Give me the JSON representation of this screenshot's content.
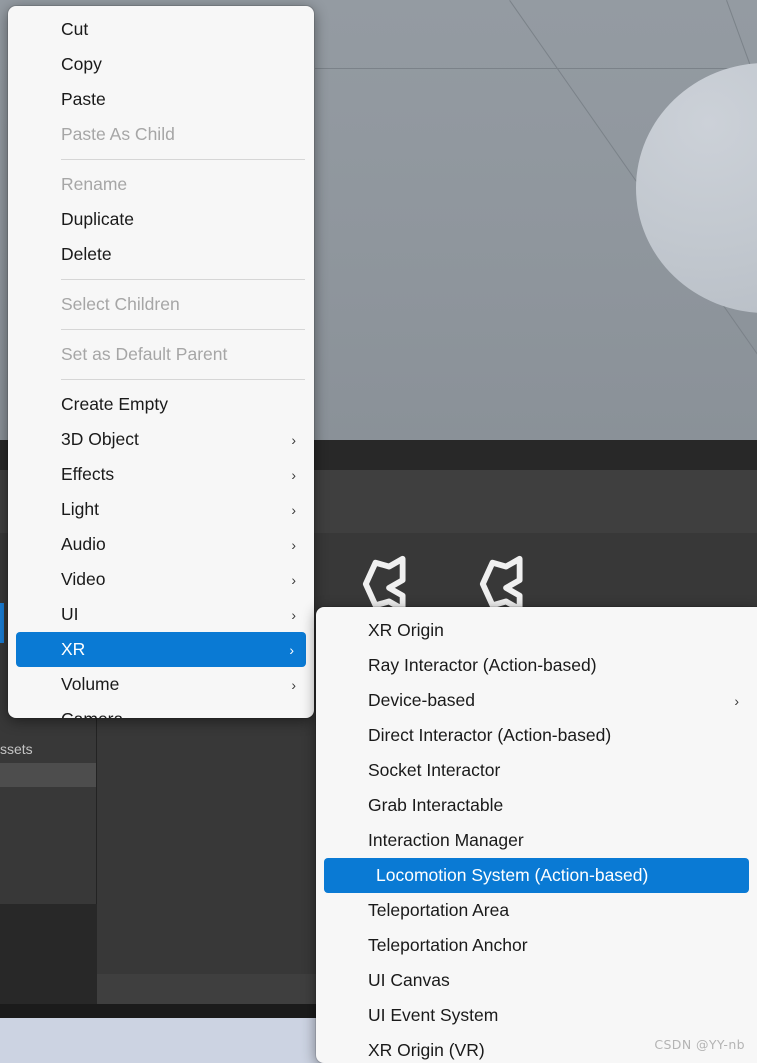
{
  "app": {
    "name": "Unity Editor",
    "watermark": "CSDN @YY-nb"
  },
  "background": {
    "scene_view": {
      "name": "Scene View",
      "objects": [
        "ground-plane",
        "sphere"
      ]
    },
    "project_panel": {
      "folder_label": "ssets",
      "asset_icons": [
        "unity-prefab-icon",
        "unity-prefab-icon"
      ]
    },
    "colors": {
      "scene_ground": "#92999f",
      "scene_sphere": "#c2c8cf",
      "panel": "#383838",
      "panel_dark": "#282828",
      "panel_mid": "#3f3f3f",
      "panel_black": "#1b1b1b",
      "status_strip": "#ccd3e2",
      "accent": "#0a7ad4"
    }
  },
  "context_menu": {
    "name": "hierarchy-context-menu",
    "items": [
      {
        "label": "Cut",
        "disabled": false,
        "submenu": false,
        "selected": false
      },
      {
        "label": "Copy",
        "disabled": false,
        "submenu": false,
        "selected": false
      },
      {
        "label": "Paste",
        "disabled": false,
        "submenu": false,
        "selected": false
      },
      {
        "label": "Paste As Child",
        "disabled": true,
        "submenu": false,
        "selected": false
      },
      {
        "separator": true
      },
      {
        "label": "Rename",
        "disabled": true,
        "submenu": false,
        "selected": false
      },
      {
        "label": "Duplicate",
        "disabled": false,
        "submenu": false,
        "selected": false
      },
      {
        "label": "Delete",
        "disabled": false,
        "submenu": false,
        "selected": false
      },
      {
        "separator": true
      },
      {
        "label": "Select Children",
        "disabled": true,
        "submenu": false,
        "selected": false
      },
      {
        "separator": true
      },
      {
        "label": "Set as Default Parent",
        "disabled": true,
        "submenu": false,
        "selected": false
      },
      {
        "separator": true
      },
      {
        "label": "Create Empty",
        "disabled": false,
        "submenu": false,
        "selected": false
      },
      {
        "label": "3D Object",
        "disabled": false,
        "submenu": true,
        "selected": false
      },
      {
        "label": "Effects",
        "disabled": false,
        "submenu": true,
        "selected": false
      },
      {
        "label": "Light",
        "disabled": false,
        "submenu": true,
        "selected": false
      },
      {
        "label": "Audio",
        "disabled": false,
        "submenu": true,
        "selected": false
      },
      {
        "label": "Video",
        "disabled": false,
        "submenu": true,
        "selected": false
      },
      {
        "label": "UI",
        "disabled": false,
        "submenu": true,
        "selected": false
      },
      {
        "label": "XR",
        "disabled": false,
        "submenu": true,
        "selected": true
      },
      {
        "label": "Volume",
        "disabled": false,
        "submenu": true,
        "selected": false
      },
      {
        "label": "Camera",
        "disabled": false,
        "submenu": false,
        "selected": false
      },
      {
        "separator": true
      }
    ]
  },
  "submenu": {
    "name": "xr-submenu",
    "parent": "XR",
    "items": [
      {
        "label": "XR Origin",
        "disabled": false,
        "submenu": false,
        "selected": false
      },
      {
        "label": "Ray Interactor (Action-based)",
        "disabled": false,
        "submenu": false,
        "selected": false
      },
      {
        "label": "Device-based",
        "disabled": false,
        "submenu": true,
        "selected": false
      },
      {
        "label": "Direct Interactor (Action-based)",
        "disabled": false,
        "submenu": false,
        "selected": false
      },
      {
        "label": "Socket Interactor",
        "disabled": false,
        "submenu": false,
        "selected": false
      },
      {
        "label": "Grab Interactable",
        "disabled": false,
        "submenu": false,
        "selected": false
      },
      {
        "label": "Interaction Manager",
        "disabled": false,
        "submenu": false,
        "selected": false
      },
      {
        "label": "Locomotion System (Action-based)",
        "disabled": false,
        "submenu": false,
        "selected": true
      },
      {
        "label": "Teleportation Area",
        "disabled": false,
        "submenu": false,
        "selected": false
      },
      {
        "label": "Teleportation Anchor",
        "disabled": false,
        "submenu": false,
        "selected": false
      },
      {
        "label": "UI Canvas",
        "disabled": false,
        "submenu": false,
        "selected": false
      },
      {
        "label": "UI Event System",
        "disabled": false,
        "submenu": false,
        "selected": false
      },
      {
        "label": "XR Origin (VR)",
        "disabled": false,
        "submenu": false,
        "selected": false
      }
    ]
  },
  "icons": {
    "chevron_right": "›"
  }
}
